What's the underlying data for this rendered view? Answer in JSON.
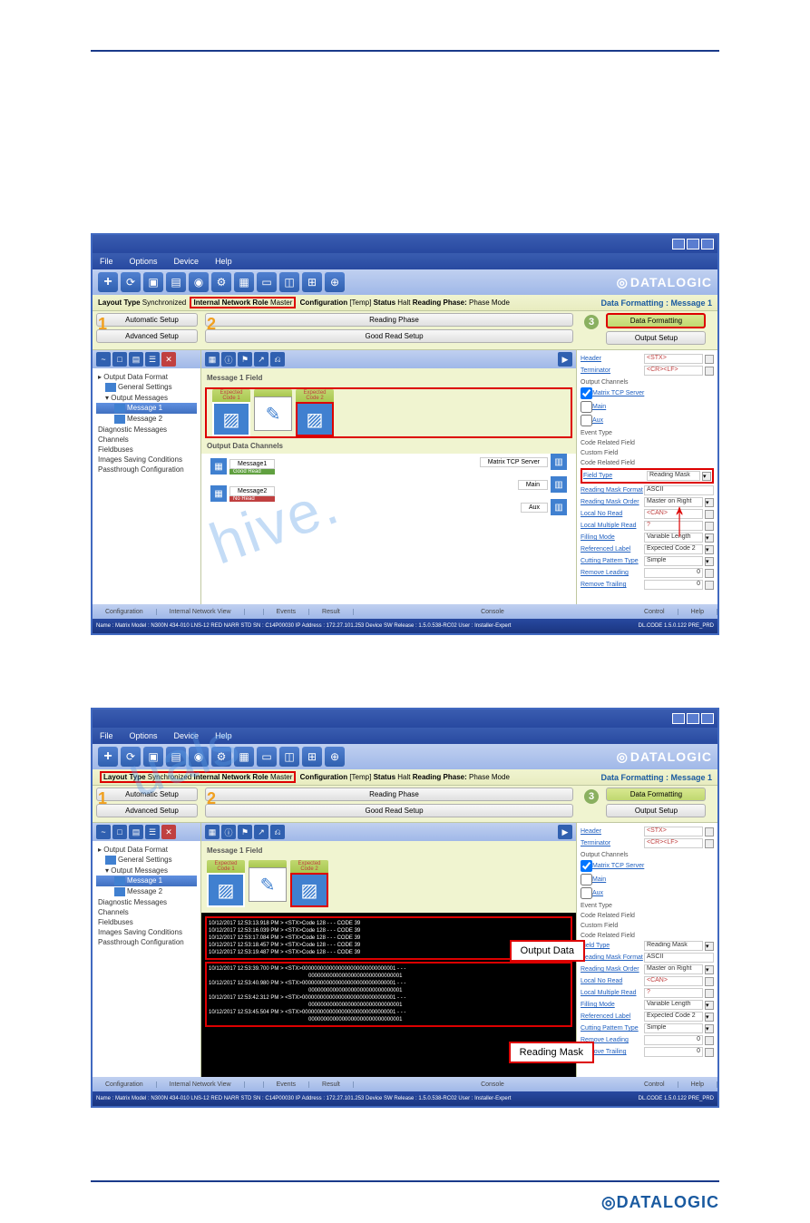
{
  "menu": {
    "file": "File",
    "options": "Options",
    "device": "Device",
    "help": "Help"
  },
  "brand": "DATALOGIC",
  "info": {
    "layoutType": "Layout Type",
    "layoutVal": "Synchronized",
    "netRole": "Internal Network Role",
    "netVal": "Master",
    "config": "Configuration",
    "configVal": "[Temp]",
    "status": "Status",
    "statusVal": "Halt",
    "phase": "Reading Phase:",
    "phaseVal": "Phase Mode",
    "panelTitle": "Data Formatting : Message 1"
  },
  "steps": {
    "n1": "1",
    "n2": "2",
    "n3": "3",
    "autoSetup": "Automatic Setup",
    "advSetup": "Advanced Setup",
    "readPhase": "Reading Phase",
    "goodRead": "Good Read Setup",
    "dataFmt": "Data Formatting",
    "outSetup": "Output Setup"
  },
  "tree": {
    "root": "Output Data Format",
    "gen": "General Settings",
    "out": "Output Messages",
    "m1": "Message 1",
    "m2": "Message 2",
    "diag": "Diagnostic Messages",
    "chan": "Channels",
    "fb": "Fieldbuses",
    "img": "Images Saving Conditions",
    "pass": "Passthrough Configuration"
  },
  "mid": {
    "msgField": "Message 1 Field",
    "ec1": "Expected Code 1",
    "ec2": "Expected Code 2",
    "outChan": "Output Data Channels",
    "msg1": "Message1",
    "msg2": "Message2",
    "good": "Good Read",
    "noread": "No Read",
    "tcp": "Matrix TCP Server",
    "main": "Main",
    "aux": "Aux"
  },
  "right": {
    "header": "Header",
    "headerV": "<STX>",
    "term": "Terminator",
    "termV": "<CR><LF>",
    "outCh": "Output Channels",
    "tcp": "Matrix TCP Server",
    "main": "Main",
    "aux": "Aux",
    "evType": "Event Type",
    "codeRF": "Code Related Field",
    "custF": "Custom Field",
    "codeRF2": "Code Related Field",
    "fieldType": "Field Type",
    "fieldTypeV": "Reading Mask",
    "rmFmt": "Reading Mask Format",
    "rmFmtV": "ASCII",
    "rmOrder": "Reading Mask Order",
    "rmOrderV": "Master on Right",
    "lnr": "Local No Read",
    "lnrV": "<CAN>",
    "lmr": "Local Multiple Read",
    "lmrV": "?",
    "fillMode": "Filling Mode",
    "fillModeV": "Variable Length",
    "refLabel": "Referenced Label",
    "refLabelV": "Expected Code  2",
    "cutPat": "Cutting Pattern Type",
    "cutPatV": "Simple",
    "remLead": "Remove Leading",
    "remLeadV": "0",
    "remTrail": "Remove Trailing",
    "remTrailV": "0"
  },
  "bottom": {
    "config": "Configuration",
    "netView": "Internal Network View",
    "events": "Events",
    "result": "Result",
    "console": "Console",
    "control": "Control",
    "help": "Help"
  },
  "status": {
    "left": "Name : Matrix   Model : N300N 434-010 LNS-12 RED NARR STD   SN : C14P00030   IP Address : 172.27.101.253   Device SW Release : 1.5.0.538-RC02   User : Installer-Expert",
    "right": "DL.CODE 1.5.0.122 PRE_PRD"
  },
  "console": {
    "l1": "10/12/2017 12:53:13.918 PM > <STX>Code 128 - - - CODE 39",
    "l2": "10/12/2017 12:53:16.039 PM > <STX>Code 128 - - - CODE 39",
    "l3": "10/12/2017 12:53:17.084 PM > <STX>Code 128 - - - CODE 39",
    "l4": "10/12/2017 12:53:18.457 PM > <STX>Code 128 - - - CODE 39",
    "l5": "10/12/2017 12:53:19.487 PM > <STX>Code 128 - - - CODE 39",
    "l6": "10/12/2017 12:53:39.700 PM > <STX>0000000000000000000000000000001 - - -",
    "l6b": "0000000000000000000000000000001",
    "l7": "10/12/2017 12:53:40.980 PM > <STX>0000000000000000000000000000001 - - -",
    "l7b": "0000000000000000000000000000001",
    "l8": "10/12/2017 12:53:42.312 PM > <STX>0000000000000000000000000000001 - - -",
    "l8b": "0000000000000000000000000000001",
    "l9": "10/12/2017 12:53:45.504 PM > <STX>0000000000000000000000000000001 - - -",
    "l9b": "0000000000000000000000000000001"
  },
  "annot": {
    "out": "Output Data",
    "rm": "Reading Mask"
  }
}
